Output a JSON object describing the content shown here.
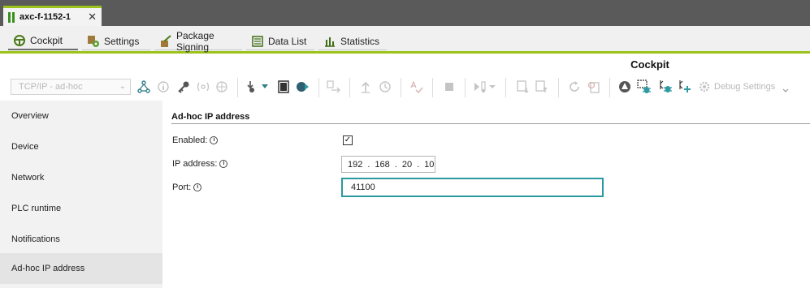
{
  "window": {
    "tab_title": "axc-f-1152-1",
    "close_glyph": "✕"
  },
  "subtabs": [
    {
      "label": "Cockpit",
      "icon": "steering-wheel-icon",
      "active": true
    },
    {
      "label": "Settings",
      "icon": "settings-gear-icon",
      "active": false
    },
    {
      "label": "Package Signing",
      "icon": "package-signing-icon",
      "active": false
    },
    {
      "label": "Data List",
      "icon": "data-list-icon",
      "active": false
    },
    {
      "label": "Statistics",
      "icon": "statistics-bar-icon",
      "active": false
    }
  ],
  "toolbar": {
    "title": "Cockpit",
    "connection_select": "TCP/IP - ad-hoc",
    "debug_settings_label": "Debug Settings"
  },
  "sidebar": {
    "items": [
      {
        "label": "Overview"
      },
      {
        "label": "Device"
      },
      {
        "label": "Network"
      },
      {
        "label": "PLC runtime"
      },
      {
        "label": "Notifications"
      },
      {
        "label": "Ad-hoc IP address",
        "active": true
      }
    ]
  },
  "form": {
    "section_title": "Ad-hoc IP address",
    "enabled_label": "Enabled:",
    "enabled_checked": true,
    "ip_label": "IP address:",
    "ip_octets": [
      "192",
      "168",
      "20",
      "10"
    ],
    "port_label": "Port:",
    "port_value": "41100"
  },
  "colors": {
    "accent_green": "#9bc31c",
    "focus_teal": "#2a9aa0",
    "topbar": "#5a5a5a"
  }
}
